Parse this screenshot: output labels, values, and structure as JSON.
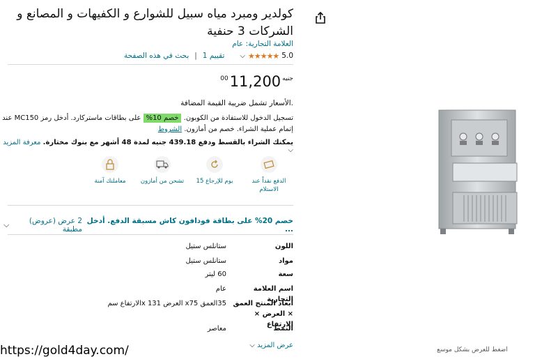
{
  "product": {
    "title": "كولدير ومبرد مياه سبيل للشوارع و الكفيهات و المصانع و الشركات 3 حنفية",
    "brand_label": "العلامة التجارية: عام",
    "rating_value": "5.0",
    "stars": "★★★★★",
    "rating_count": "تقييم 1",
    "search_page": "بحث في هذه الصفحة"
  },
  "price": {
    "currency": "جنيه",
    "whole": "11,200",
    "fraction": "00",
    "vat_note": ".الأسعار تشمل ضريبة القيمة المضافة"
  },
  "coupon": {
    "line1_pre": "تسجيل الدخول للاستفادة من الكوبون.",
    "badge": "خصم 10%",
    "line1_post": "على بطاقات ماستركارد. أدخل رمز MC150 عند",
    "line2": "إتمام عملية الشراء. خصم من أمازون.",
    "terms": "الشروط"
  },
  "installment": {
    "text": "يمكنك الشراء بالقسط ودفع 439.18 جنيه لمدة 48 أشهر مع بنوك مختارة.",
    "more": "معرفة المزيد"
  },
  "services": [
    {
      "icon": "cash-on-delivery-icon",
      "label": "الدفع نقداً عند الاستلام"
    },
    {
      "icon": "return-icon",
      "label": "15 يوم للإرجاع"
    },
    {
      "icon": "shipping-truck-icon",
      "label": "تشحن من أمازون"
    },
    {
      "icon": "secure-transaction-icon",
      "label": "معاملتك آمنة"
    }
  ],
  "offer": {
    "main": "خصم 20% على بطاقة فودافون كاش مسبقة الدفع. أدخل ...",
    "count": "2 عرض (عروض) مطبقة"
  },
  "specs": [
    {
      "key": "اللون",
      "value": "ستانلس ستيل"
    },
    {
      "key": "مواد",
      "value": "ستانلس ستيل"
    },
    {
      "key": "سعة",
      "value": "60 ليتر"
    },
    {
      "key": "اسم العلامة التجارية",
      "value": "عام"
    },
    {
      "key": "أبعاد المنتج العمق × العرض × الارتفاع",
      "value": "35العمق x75 العرض 131 xالارتفاع سم"
    },
    {
      "key": "النمط",
      "value": "معاصر"
    }
  ],
  "see_more": "عرض المزيد",
  "zoom_hint": "اضغط للعرض بشكل موسع",
  "watermark": "https://gold4day.com/",
  "colors": {
    "link": "#007185",
    "star": "#de7921",
    "badge": "#7fda69"
  }
}
